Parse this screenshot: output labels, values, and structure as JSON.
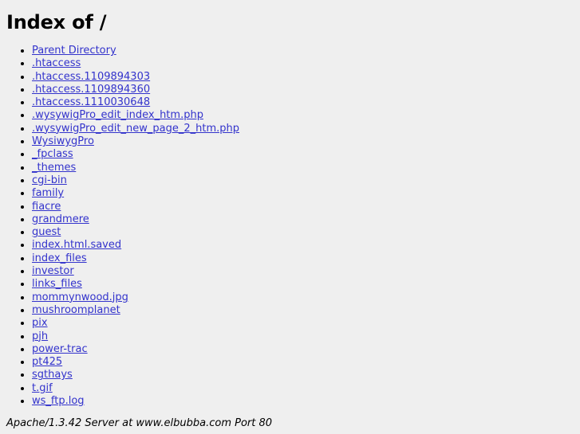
{
  "page": {
    "title": "Index of /",
    "background_color": "#efefef",
    "text_color": "#000000",
    "link_color": "#3333cc"
  },
  "listing": {
    "entries": [
      {
        "label": "Parent Directory"
      },
      {
        "label": ".htaccess"
      },
      {
        "label": ".htaccess.1109894303"
      },
      {
        "label": ".htaccess.1109894360"
      },
      {
        "label": ".htaccess.1110030648"
      },
      {
        "label": ".wysywigPro_edit_index_htm.php"
      },
      {
        "label": ".wysywigPro_edit_new_page_2_htm.php"
      },
      {
        "label": "WysiwygPro"
      },
      {
        "label": "_fpclass"
      },
      {
        "label": "_themes"
      },
      {
        "label": "cgi-bin"
      },
      {
        "label": "family"
      },
      {
        "label": "fiacre"
      },
      {
        "label": "grandmere"
      },
      {
        "label": "guest"
      },
      {
        "label": "index.html.saved"
      },
      {
        "label": "index_files"
      },
      {
        "label": "investor"
      },
      {
        "label": "links_files"
      },
      {
        "label": "mommynwood.jpg"
      },
      {
        "label": "mushroomplanet"
      },
      {
        "label": "pix"
      },
      {
        "label": "pjh"
      },
      {
        "label": "power-trac"
      },
      {
        "label": "pt425"
      },
      {
        "label": "sgthays"
      },
      {
        "label": "t.gif"
      },
      {
        "label": "ws_ftp.log"
      }
    ]
  },
  "footer": {
    "signature": "Apache/1.3.42 Server at www.elbubba.com Port 80"
  }
}
